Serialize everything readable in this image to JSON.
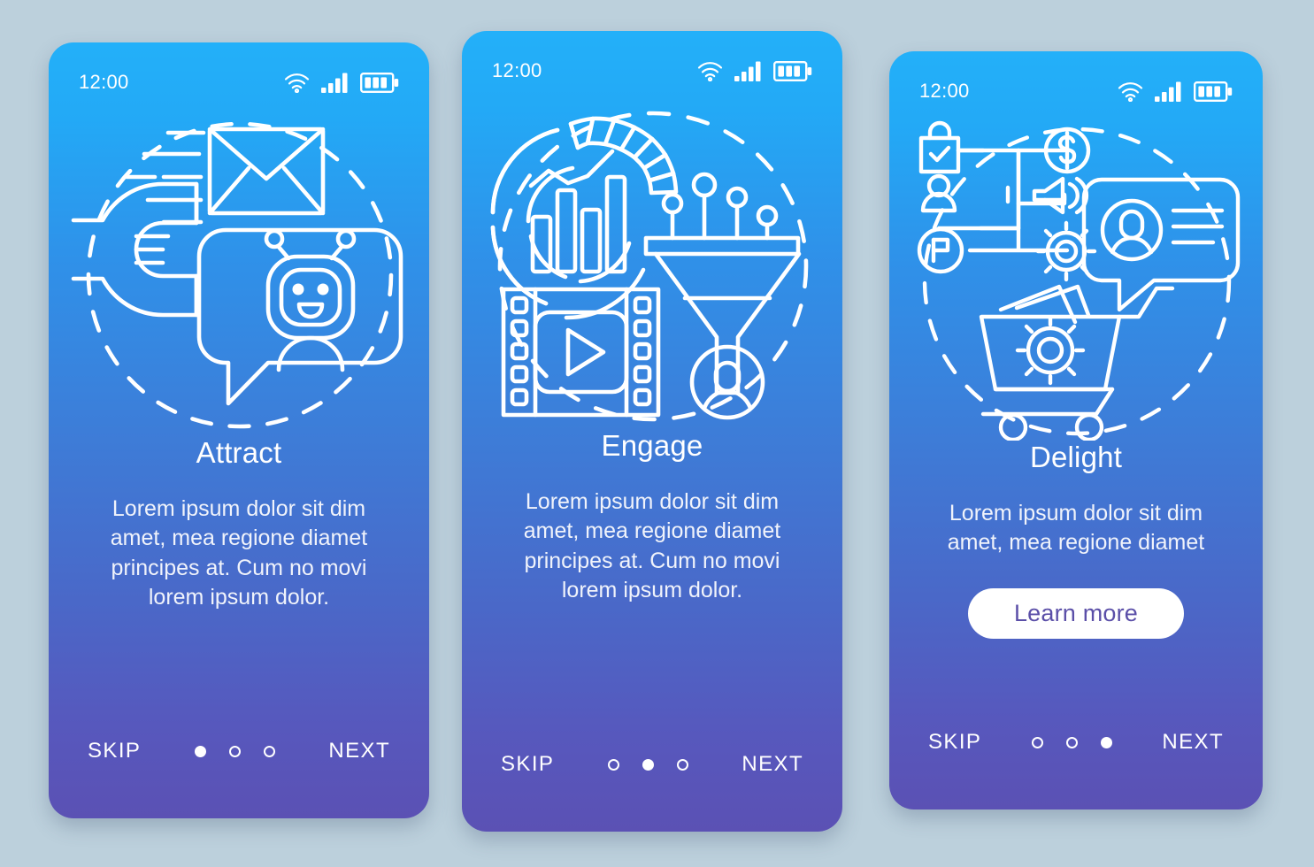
{
  "background_color": "#bcd0dc",
  "theme": {
    "gradient_top": "#23b0f9",
    "gradient_mid": "#3d7dd8",
    "gradient_bottom": "#5b51b4",
    "line_art_color": "#ffffff",
    "cta_background": "#ffffff",
    "cta_text_color": "#5b4fa8"
  },
  "screens": [
    {
      "id": "attract",
      "status": {
        "time": "12:00",
        "icons": [
          "wifi-icon",
          "cellular-signal-icon",
          "battery-icon"
        ]
      },
      "illustration": {
        "name": "attract-illustration",
        "elements": [
          "magnet-icon",
          "envelope-icon",
          "speed-lines",
          "chatbot-speech-bubble-icon",
          "dashed-circle"
        ]
      },
      "title": "Attract",
      "description": "Lorem ipsum dolor sit dim amet, mea regione diamet principes at. Cum no movi lorem ipsum dolor.",
      "cta": null,
      "nav": {
        "skip_label": "SKIP",
        "next_label": "NEXT",
        "dot_count": 3,
        "active_dot": 0
      }
    },
    {
      "id": "engage",
      "status": {
        "time": "12:00",
        "icons": [
          "wifi-icon",
          "cellular-signal-icon",
          "battery-icon"
        ]
      },
      "illustration": {
        "name": "engage-illustration",
        "elements": [
          "analytics-donut-chart-icon",
          "film-play-icon",
          "sales-funnel-icon",
          "user-avatar-icon",
          "dashed-circle"
        ]
      },
      "title": "Engage",
      "description": "Lorem ipsum dolor sit dim amet, mea regione diamet principes at. Cum no movi lorem ipsum dolor.",
      "cta": null,
      "nav": {
        "skip_label": "SKIP",
        "next_label": "NEXT",
        "dot_count": 3,
        "active_dot": 1
      }
    },
    {
      "id": "delight",
      "status": {
        "time": "12:00",
        "icons": [
          "wifi-icon",
          "cellular-signal-icon",
          "battery-icon"
        ]
      },
      "illustration": {
        "name": "delight-illustration",
        "elements": [
          "shopping-bag-check-icon",
          "user-icon",
          "flag-badge-icon",
          "dollar-coin-icon",
          "megaphone-icon",
          "gear-icon",
          "customer-profile-speech-bubble-icon",
          "shopping-cart-gear-icon",
          "dashed-circle"
        ]
      },
      "title": "Delight",
      "description": "Lorem ipsum dolor sit dim amet, mea regione diamet",
      "cta": "Learn more",
      "nav": {
        "skip_label": "SKIP",
        "next_label": "NEXT",
        "dot_count": 3,
        "active_dot": 2
      }
    }
  ]
}
